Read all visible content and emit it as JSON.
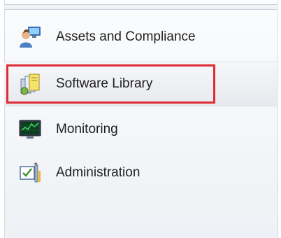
{
  "nav": {
    "items": [
      {
        "label": "Assets and Compliance",
        "icon": "assets-and-compliance-icon"
      },
      {
        "label": "Software Library",
        "icon": "software-library-icon",
        "selected": true
      },
      {
        "label": "Monitoring",
        "icon": "monitoring-icon"
      },
      {
        "label": "Administration",
        "icon": "administration-icon"
      }
    ]
  },
  "colors": {
    "highlight": "#e02b35"
  }
}
